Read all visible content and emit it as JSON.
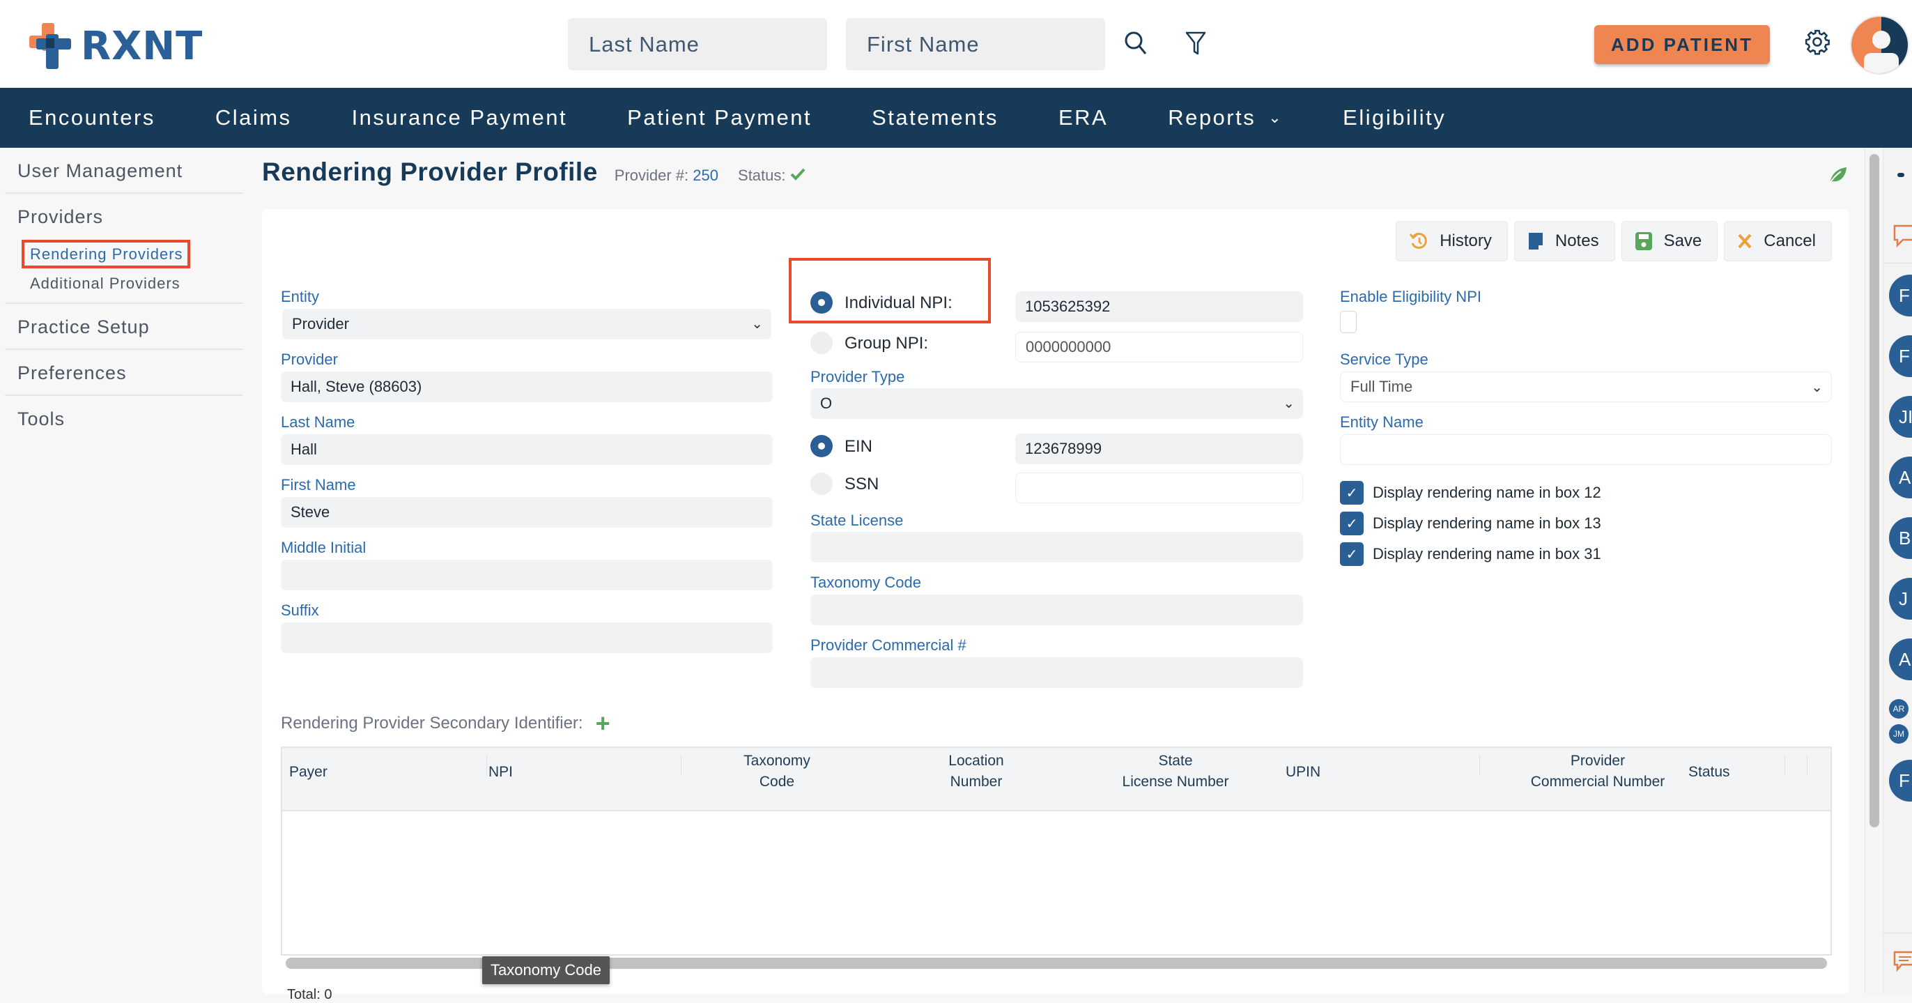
{
  "app": {
    "brand": "RXNT"
  },
  "header": {
    "search": {
      "last_name_placeholder": "Last Name",
      "first_name_placeholder": "First Name"
    },
    "add_patient_label": "ADD PATIENT",
    "icons": [
      "search-icon",
      "filter-icon",
      "gear-icon",
      "user-avatar"
    ]
  },
  "nav": {
    "items": [
      {
        "label": "Encounters"
      },
      {
        "label": "Claims"
      },
      {
        "label": "Insurance Payment"
      },
      {
        "label": "Patient Payment"
      },
      {
        "label": "Statements"
      },
      {
        "label": "ERA"
      },
      {
        "label": "Reports",
        "has_dropdown": true
      },
      {
        "label": "Eligibility"
      }
    ]
  },
  "sidebar": {
    "user_management": "User Management",
    "providers": "Providers",
    "rendering_providers": "Rendering Providers",
    "additional_providers": "Additional Providers",
    "practice_setup": "Practice Setup",
    "preferences": "Preferences",
    "tools": "Tools",
    "active_item": "Rendering Providers"
  },
  "page": {
    "title": "Rendering Provider Profile",
    "provider_num_label": "Provider #:",
    "provider_num": "250",
    "status_label": "Status:",
    "status": "active"
  },
  "toolbar": {
    "history": "History",
    "notes": "Notes",
    "save": "Save",
    "cancel": "Cancel"
  },
  "form": {
    "entity": {
      "label": "Entity",
      "value": "Provider"
    },
    "provider": {
      "label": "Provider",
      "value": "Hall, Steve  (88603)"
    },
    "last_name": {
      "label": "Last Name",
      "value": "Hall"
    },
    "first_name": {
      "label": "First Name",
      "value": "Steve"
    },
    "middle_initial": {
      "label": "Middle Initial",
      "value": ""
    },
    "suffix": {
      "label": "Suffix",
      "value": ""
    },
    "individual_npi": {
      "label": "Individual NPI:",
      "value": "1053625392",
      "selected": true
    },
    "group_npi": {
      "label": "Group NPI:",
      "value": "0000000000",
      "selected": false
    },
    "provider_type": {
      "label": "Provider Type",
      "value": "O"
    },
    "ein": {
      "label": "EIN",
      "value": "123678999",
      "selected": true
    },
    "ssn": {
      "label": "SSN",
      "value": "",
      "selected": false
    },
    "state_license": {
      "label": "State License",
      "value": ""
    },
    "taxonomy_code": {
      "label": "Taxonomy Code",
      "value": ""
    },
    "provider_commercial": {
      "label": "Provider Commercial #",
      "value": ""
    },
    "enable_eligibility_npi": {
      "label": "Enable Eligibility NPI",
      "checked": false
    },
    "service_type": {
      "label": "Service Type",
      "value": "Full Time"
    },
    "entity_name": {
      "label": "Entity Name",
      "value": ""
    },
    "display_box_12": {
      "label": "Display rendering name in box 12",
      "checked": true
    },
    "display_box_13": {
      "label": "Display rendering name in box 13",
      "checked": true
    },
    "display_box_31": {
      "label": "Display rendering name in box 31",
      "checked": true
    }
  },
  "secondary_identifier": {
    "title": "Rendering Provider Secondary Identifier:",
    "columns": [
      "Payer",
      "NPI",
      "Taxonomy\nCode",
      "Location\nNumber",
      "State\nLicense Number",
      "UPIN",
      "Provider\nCommercial Number",
      "Status"
    ],
    "rows": [],
    "tooltip": "Taxonomy Code",
    "total_label": "Total: 0"
  },
  "right_rail": {
    "avatars": [
      "F",
      "F",
      "JI",
      "A",
      "B",
      "J",
      "A",
      "AR",
      "JM",
      "F"
    ]
  },
  "colors": {
    "primary": "#173a59",
    "accent": "#ef8551",
    "link": "#2a6aad",
    "success": "#58a65c",
    "highlight": "#e94a2b"
  }
}
